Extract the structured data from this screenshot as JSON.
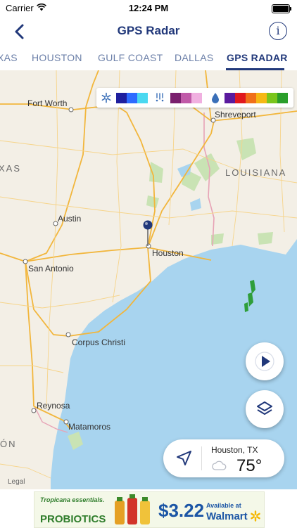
{
  "status_bar": {
    "carrier": "Carrier",
    "time": "12:24 PM"
  },
  "nav": {
    "title": "GPS Radar"
  },
  "tabs": [
    {
      "label": "XAS",
      "active": false
    },
    {
      "label": "HOUSTON",
      "active": false
    },
    {
      "label": "GULF COAST",
      "active": false
    },
    {
      "label": "DALLAS",
      "active": false
    },
    {
      "label": "GPS RADAR",
      "active": true
    }
  ],
  "legend": {
    "snow_icon": "snowflake-icon",
    "mix_icon": "mixed-precip-icon",
    "rain_icon": "raindrop-icon",
    "snow_colors": [
      "#1f1f9e",
      "#2e6bff",
      "#4ad8f0"
    ],
    "mix_colors": [
      "#7a1f6e",
      "#c05aa8",
      "#f0b0e0"
    ],
    "rain_colors": [
      "#5a1a9e",
      "#e0181e",
      "#f0701a",
      "#f5b814",
      "#7ac51c",
      "#2a9e2a"
    ]
  },
  "map": {
    "cities": [
      "Fort Worth",
      "Shreveport",
      "Austin",
      "Houston",
      "San Antonio",
      "Corpus Christi",
      "Reynosa",
      "Matamoros"
    ],
    "regions": [
      "XAS",
      "LOUISIANA",
      "ÓN"
    ],
    "legal": "Legal",
    "colors": {
      "land": "#f3efe6",
      "water": "#a8d4ef",
      "highway": "#f2b63c",
      "park": "#c9e3b4"
    }
  },
  "controls": {
    "play_icon": "play-icon",
    "layers_icon": "layers-icon",
    "location_icon": "location-arrow-icon"
  },
  "weather": {
    "location": "Houston, TX",
    "temperature": "75°",
    "condition_icon": "cloud-icon"
  },
  "ad": {
    "brand": "Tropicana essentials.",
    "product": "PROBIOTICS",
    "price": "$3.22",
    "available": "Available at",
    "store": "Walmart"
  }
}
